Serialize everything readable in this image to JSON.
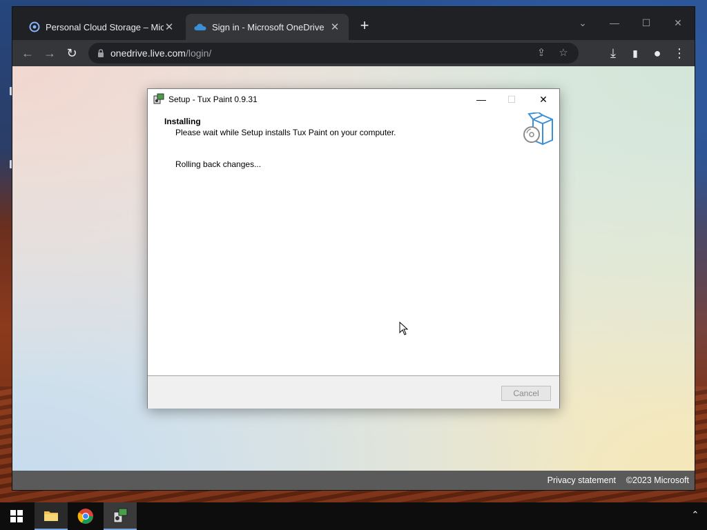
{
  "browser": {
    "tabs": [
      {
        "title": "Personal Cloud Storage – Micros",
        "icon": "onedrive-ring-icon",
        "active": false
      },
      {
        "title": "Sign in - Microsoft OneDrive",
        "icon": "onedrive-cloud-icon",
        "active": true
      }
    ],
    "new_tab_label": "+",
    "window_controls": {
      "tab_search": "⌄",
      "minimize": "—",
      "maximize": "☐",
      "close": "✕"
    },
    "toolbar": {
      "back": "←",
      "forward": "→",
      "reload": "↻",
      "url_host": "onedrive.live.com",
      "url_path": "/login/",
      "share": "⇪",
      "bookmark": "☆",
      "download": "⤓",
      "side_panel": "▮",
      "profile": "●",
      "menu": "⋮"
    }
  },
  "page": {
    "footer": {
      "privacy": "Privacy statement",
      "copyright": "©2023 Microsoft"
    }
  },
  "setup_dialog": {
    "title": "Setup - Tux Paint 0.9.31",
    "heading": "Installing",
    "description": "Please wait while Setup installs Tux Paint on your computer.",
    "status": "Rolling back changes...",
    "cancel_label": "Cancel",
    "cancel_enabled": false,
    "controls": {
      "minimize": "—",
      "maximize": "☐",
      "close": "✕"
    }
  },
  "taskbar": {
    "items": [
      "start-icon",
      "file-explorer-icon",
      "chrome-icon",
      "tux-paint-setup-icon"
    ],
    "tray_chevron": "⌃"
  },
  "colors": {
    "chrome_dark": "#202124",
    "chrome_toolbar": "#35363a",
    "footer_bar": "#5a5a5a",
    "dialog_panel": "#f0f0f0",
    "accent_blue": "#3b8fd6"
  }
}
